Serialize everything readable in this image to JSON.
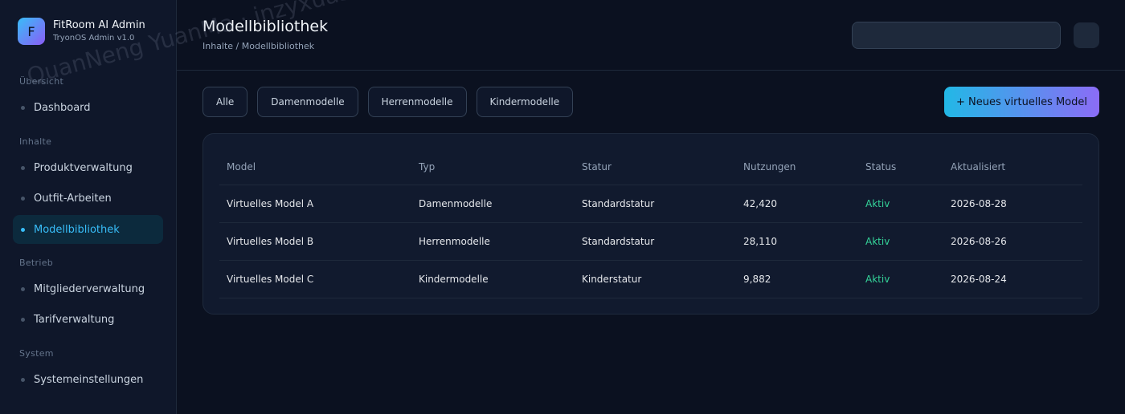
{
  "sidebar": {
    "brand": {
      "logo_letter": "F",
      "name": "FitRoom AI Admin",
      "subtitle": "TryonOS Admin v1.0"
    },
    "sections": [
      {
        "label": "Übersicht",
        "items": [
          {
            "label": "Dashboard",
            "active": false
          }
        ]
      },
      {
        "label": "Inhalte",
        "items": [
          {
            "label": "Produktverwaltung",
            "active": false
          },
          {
            "label": "Outfit-Arbeiten",
            "active": false
          },
          {
            "label": "Modellbibliothek",
            "active": true
          }
        ]
      },
      {
        "label": "Betrieb",
        "items": [
          {
            "label": "Mitgliederverwaltung",
            "active": false
          },
          {
            "label": "Tarifverwaltung",
            "active": false
          }
        ]
      },
      {
        "label": "System",
        "items": [
          {
            "label": "Systemeinstellungen",
            "active": false
          }
        ]
      }
    ]
  },
  "header": {
    "title": "Modellbibliothek",
    "breadcrumb": "Inhalte / Modellbibliothek",
    "search_placeholder": ""
  },
  "filters": [
    "Alle",
    "Damenmodelle",
    "Herrenmodelle",
    "Kindermodelle"
  ],
  "new_model_button": "+ Neues virtuelles Model",
  "table": {
    "columns": [
      "Model",
      "Typ",
      "Statur",
      "Nutzungen",
      "Status",
      "Aktualisiert"
    ],
    "rows": [
      [
        "Virtuelles Model A",
        "Damenmodelle",
        "Standardstatur",
        "42,420",
        "Aktiv",
        "2026-08-28"
      ],
      [
        "Virtuelles Model B",
        "Herrenmodelle",
        "Standardstatur",
        "28,110",
        "Aktiv",
        "2026-08-26"
      ],
      [
        "Virtuelles Model C",
        "Kindermodelle",
        "Kinderstatur",
        "9,882",
        "Aktiv",
        "2026-08-24"
      ]
    ]
  },
  "watermark": "QuanNeng YuanMa · inzyxuashop.com",
  "colors": {
    "accent": "#38bdf8",
    "accent_gradient_end": "#8b5cf6",
    "status_active": "#34d399",
    "background": "#0b1120"
  }
}
